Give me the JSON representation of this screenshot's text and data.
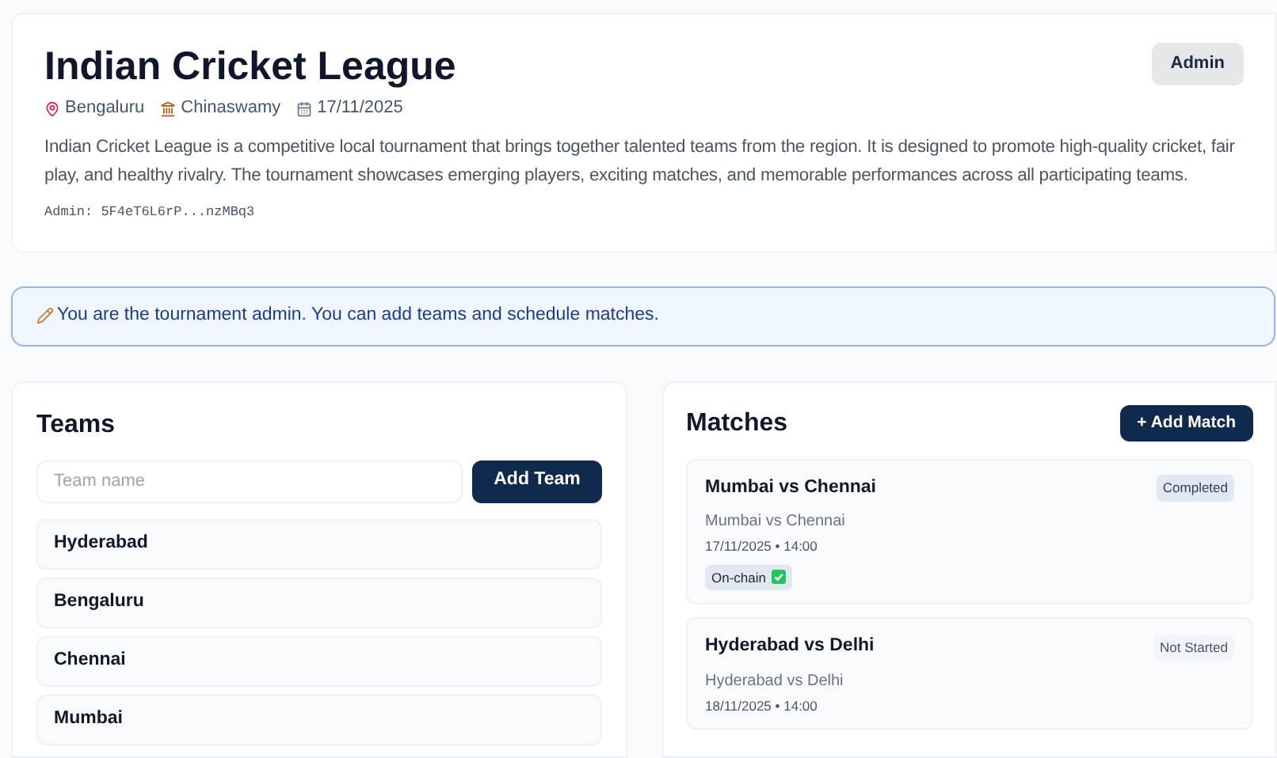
{
  "tournament": {
    "title": "Indian Cricket League",
    "role_badge": "Admin",
    "meta": [
      {
        "kind": "location",
        "text": "Bengaluru"
      },
      {
        "kind": "venue",
        "text": "Chinaswamy"
      },
      {
        "kind": "date",
        "text": "17/11/2025"
      }
    ],
    "description": "Indian Cricket League is a competitive local tournament that brings together talented teams from the region. It is designed to promote high-quality cricket, fair play, and healthy rivalry. The tournament showcases emerging players, exciting matches, and memorable performances across all participating teams.",
    "admin": "Admin: 5F4eT6L6rP...nzMBq3"
  },
  "notice": "You are the tournament admin. You can add teams and schedule matches.",
  "teams": {
    "title": "Teams",
    "input": {
      "placeholder": "Team name"
    },
    "add_button": "Add Team",
    "items": [
      "Hyderabad",
      "Bengaluru",
      "Chennai",
      "Mumbai"
    ]
  },
  "matches": {
    "title": "Matches",
    "add_button": "+ Add Match",
    "items": [
      {
        "title": "Mumbai vs Chennai",
        "status": "Completed",
        "kind": "completed",
        "subtitle": "Mumbai vs Chennai",
        "when": "17/11/2025 • 14:00",
        "on_chain": true,
        "chain_label": "On-chain"
      },
      {
        "title": "Hyderabad vs Delhi",
        "status": "Not Started",
        "kind": "not_started",
        "subtitle": "Hyderabad vs Delhi",
        "when": "18/11/2025 • 14:00",
        "on_chain": false
      }
    ]
  }
}
